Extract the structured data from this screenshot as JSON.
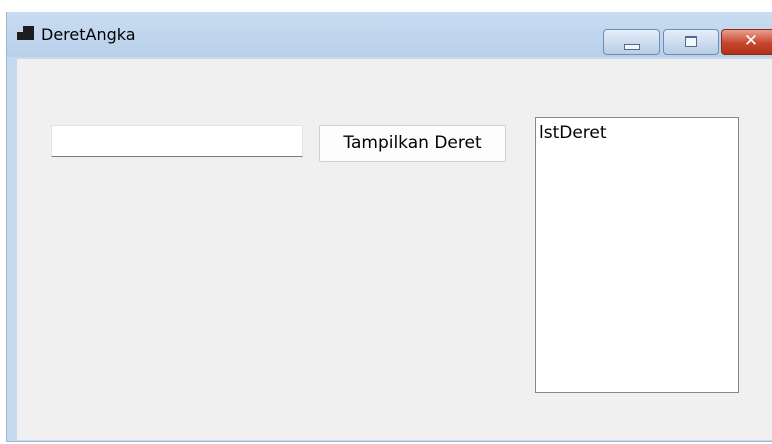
{
  "window": {
    "title": "DeretAngka",
    "close_glyph": "✕"
  },
  "form": {
    "input_value": "",
    "button_label": "Tampilkan Deret",
    "listbox_items": [
      "lstDeret"
    ]
  },
  "icons": {
    "app": "app-window-icon",
    "minimize": "minimize-icon",
    "maximize": "maximize-icon",
    "close": "close-icon"
  },
  "colors": {
    "titlebar": "#c5d9ef",
    "client": "#f0f0f0",
    "close_button": "#c7452d"
  }
}
